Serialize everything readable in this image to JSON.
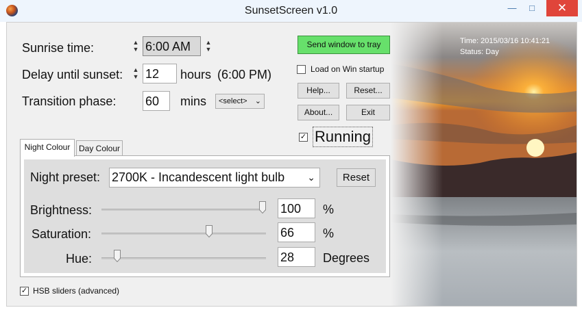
{
  "window": {
    "title": "SunsetScreen v1.0",
    "minimize": "—",
    "maximize": "□",
    "close": "✕"
  },
  "settings": {
    "sunrise_label": "Sunrise time:",
    "sunrise_value": "6:00 AM",
    "delay_label": "Delay until sunset:",
    "delay_value": "12",
    "delay_unit": "hours",
    "delay_result": "(6:00 PM)",
    "transition_label": "Transition phase:",
    "transition_value": "60",
    "transition_unit": "mins",
    "transition_select": "<select>"
  },
  "buttons": {
    "tray": "Send window to tray",
    "load_startup": "Load on Win startup",
    "help": "Help...",
    "reset": "Reset...",
    "about": "About...",
    "exit": "Exit",
    "running": "Running"
  },
  "tabs": [
    "Night Colour",
    "Day Colour"
  ],
  "night": {
    "preset_label": "Night preset:",
    "preset_value": "2700K - Incandescent light bulb",
    "reset": "Reset",
    "brightness_label": "Brightness:",
    "brightness_value": "100",
    "brightness_unit": "%",
    "saturation_label": "Saturation:",
    "saturation_value": "66",
    "saturation_unit": "%",
    "hue_label": "Hue:",
    "hue_value": "28",
    "hue_unit": "Degrees"
  },
  "sliders": {
    "brightness_fraction": 1.0,
    "saturation_fraction": 0.66,
    "hue_fraction": 0.08
  },
  "advanced_label": "HSB sliders (advanced)",
  "status": {
    "time": "Time: 2015/03/16 10:41:21",
    "status": "Status: Day"
  },
  "checks": {
    "load_startup": false,
    "running": true,
    "advanced": true
  },
  "colors": {
    "tray_button": "#67e06b",
    "close_button": "#e0453a"
  }
}
